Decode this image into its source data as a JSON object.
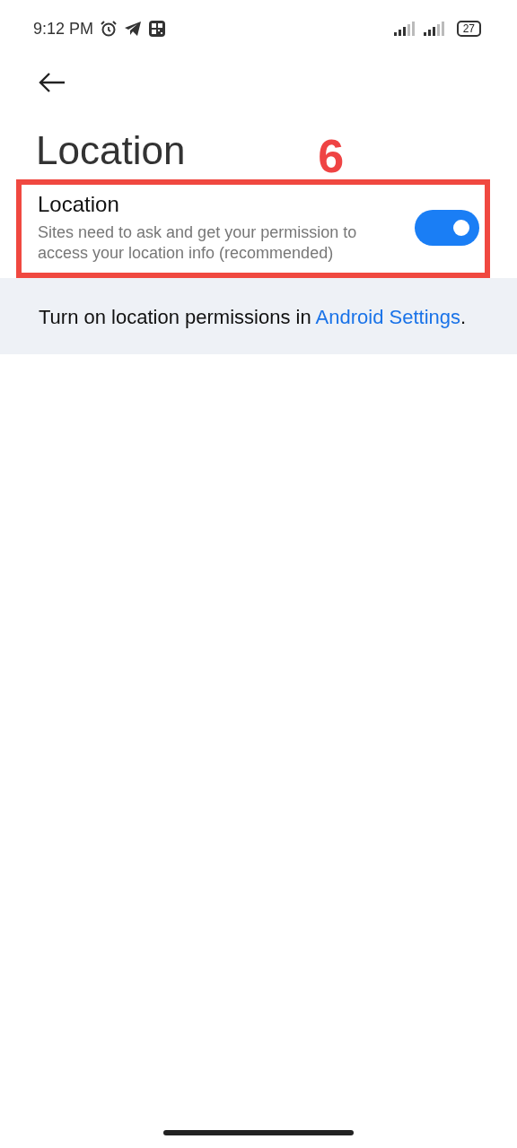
{
  "status_bar": {
    "time": "9:12 PM",
    "battery": "27"
  },
  "page": {
    "title": "Location"
  },
  "annotation": {
    "label": "6"
  },
  "setting": {
    "title": "Location",
    "description": "Sites need to ask and get your permission to access your location info (recommended)",
    "on": true
  },
  "notice": {
    "text": "Turn on location permissions in ",
    "link": "Android Settings",
    "after": "."
  }
}
